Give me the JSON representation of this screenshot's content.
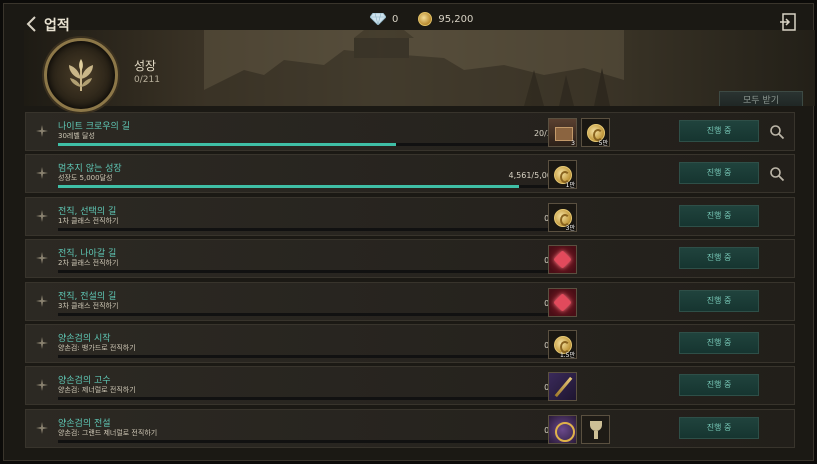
{
  "header": {
    "title": "업적",
    "gems": "0",
    "gold": "95,200"
  },
  "banner": {
    "title": "성장",
    "count": "0/211",
    "claim_all_label": "모두 받기"
  },
  "rows": [
    {
      "title": "나이트 크로우의 길",
      "desc": "30레벨 달성",
      "count": "20/30",
      "progress": 0.667,
      "rewards": [
        {
          "type": "chest",
          "qty": "3"
        },
        {
          "type": "coin",
          "qty": "5만"
        }
      ],
      "status": "진행 중",
      "has_search": true
    },
    {
      "title": "멈추지 않는 성장",
      "desc": "성장도 5,000달성",
      "count": "4,561/5,000",
      "progress": 0.912,
      "rewards": [
        {
          "type": "coin",
          "qty": "1만"
        }
      ],
      "status": "진행 중",
      "has_search": true
    },
    {
      "title": "전직, 선택의 길",
      "desc": "1차 클래스 전직하기",
      "count": "0/1",
      "progress": 0,
      "rewards": [
        {
          "type": "coin",
          "qty": "3만"
        }
      ],
      "status": "진행 중",
      "has_search": false
    },
    {
      "title": "전직, 나아갈 길",
      "desc": "2차 클래스 전직하기",
      "count": "0/1",
      "progress": 0,
      "rewards": [
        {
          "type": "gem-red",
          "qty": ""
        }
      ],
      "status": "진행 중",
      "has_search": false
    },
    {
      "title": "전직, 전설의 길",
      "desc": "3차 클래스 전직하기",
      "count": "0/1",
      "progress": 0,
      "rewards": [
        {
          "type": "gem-red",
          "qty": ""
        }
      ],
      "status": "진행 중",
      "has_search": false
    },
    {
      "title": "양손검의 시작",
      "desc": "양손검: 뱅가드로 전직하기",
      "count": "0/1",
      "progress": 0,
      "rewards": [
        {
          "type": "coin",
          "qty": "1.5만"
        }
      ],
      "status": "진행 중",
      "has_search": false
    },
    {
      "title": "양손검의 고수",
      "desc": "양손검: 제너럴로 전직하기",
      "count": "0/1",
      "progress": 0,
      "rewards": [
        {
          "type": "sword",
          "qty": ""
        }
      ],
      "status": "진행 중",
      "has_search": false
    },
    {
      "title": "양손검의 전설",
      "desc": "양손검: 그랜드 제너럴로 전직하기",
      "count": "0/1",
      "progress": 0,
      "rewards": [
        {
          "type": "emblem-item",
          "qty": ""
        },
        {
          "type": "trophy",
          "qty": ""
        }
      ],
      "status": "진행 중",
      "has_search": false
    }
  ]
}
